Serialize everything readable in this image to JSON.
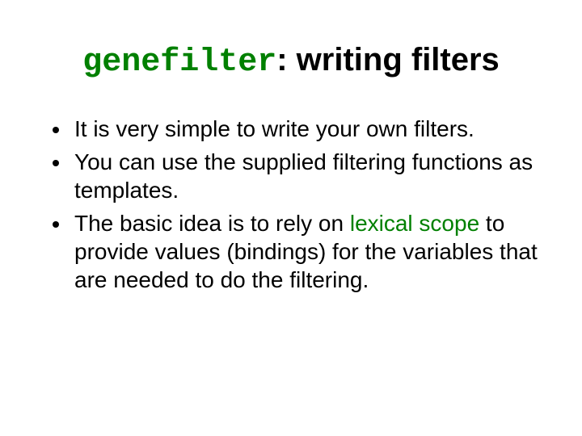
{
  "title": {
    "code": "genefilter",
    "rest": ": writing filters"
  },
  "bullets": [
    {
      "pre": "It is very simple to write your own filters.",
      "hl": "",
      "post": ""
    },
    {
      "pre": "You can use the supplied filtering functions as templates.",
      "hl": "",
      "post": ""
    },
    {
      "pre": "The basic idea is to rely on ",
      "hl": "lexical scope",
      "post": " to provide values (bindings) for the variables that are needed to do the filtering."
    }
  ]
}
